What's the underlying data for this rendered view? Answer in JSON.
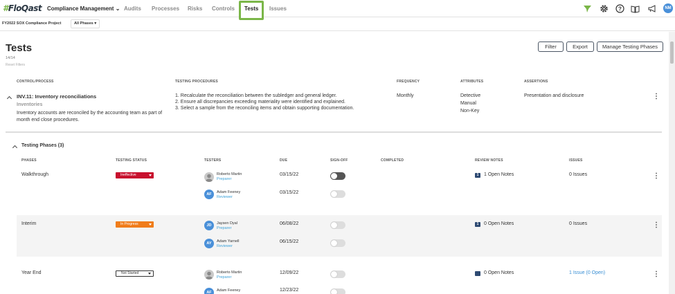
{
  "nav": {
    "logo": "FloQast",
    "items": [
      "Compliance Management",
      "Audits",
      "Processes",
      "Risks",
      "Controls",
      "Tests",
      "Issues"
    ],
    "user_initials": "NM"
  },
  "subnav": {
    "project": "FY2022 SOX Compliance Project",
    "phase_filter": "All Phases"
  },
  "page": {
    "title": "Tests",
    "count": "14/14",
    "reset": "Reset Filters",
    "buttons": {
      "filter": "Filter",
      "export": "Export",
      "manage": "Manage Testing Phases"
    }
  },
  "control_table": {
    "headers": [
      "CONTROL/PROCESS",
      "TESTING PROCEDURES",
      "FREQUENCY",
      "ATTRIBUTES",
      "ASSERTIONS"
    ],
    "control": {
      "name": "INV.11: Inventory reconciliations",
      "process": "Inventories",
      "description_1": "Inventory accounts are reconciled by the accounting team as part of",
      "description_2": "month end close procedures.",
      "procedure_1": "1. Recalculate the reconciliation between the subledger and general ledger.",
      "procedure_2": "2. Ensure all discrepancies exceeding materiality were identified and explained.",
      "procedure_3": "3. Select a sample from the reconciling items and obtain supporting documentation.",
      "frequency": "Monthly",
      "attributes": [
        "Detective",
        "Manual",
        "Non-Key"
      ],
      "assertion": "Presentation and disclosure"
    }
  },
  "phases": {
    "title": "Testing Phases (3)",
    "headers": [
      "PHASES",
      "TESTING STATUS",
      "TESTERS",
      "DUE",
      "SIGN-OFF",
      "COMPLETED",
      "REVIEW NOTES",
      "ISSUES"
    ],
    "rows": [
      {
        "phase": "Walkthrough",
        "status": "Ineffective",
        "tester1": {
          "name": "Roberto Martin",
          "role": "Preparer",
          "due": "03/15/22"
        },
        "tester2": {
          "initials": "AF",
          "name": "Adam Feeney",
          "role": "Reviewer",
          "due": "03/15/22"
        },
        "notes": "1 Open Notes",
        "notes_count": "1",
        "issues": "0 Issues"
      },
      {
        "phase": "Interim",
        "status": "In Progress",
        "tester1": {
          "initials": "JD",
          "name": "Jaysen Dyal",
          "role": "Preparer",
          "due": "06/08/22"
        },
        "tester2": {
          "initials": "AY",
          "name": "Adam Yarnell",
          "role": "Reviewer",
          "due": "06/15/22"
        },
        "notes": "0 Open Notes",
        "notes_count": "1",
        "issues": "0 Issues"
      },
      {
        "phase": "Year End",
        "status": "Not Started",
        "tester1": {
          "name": "Roberto Martin",
          "role": "Preparer",
          "due": "12/09/22"
        },
        "tester2": {
          "initials": "AF",
          "name": "Adam Feeney",
          "due": "12/23/22"
        },
        "notes": "0 Open Notes",
        "issues": "1 Issue (0 Open)"
      }
    ]
  },
  "colors": {
    "accent_green": "#7ab648",
    "ineffective": "#c8102e",
    "in_progress": "#f07d1a",
    "link": "#3a8fd4"
  }
}
